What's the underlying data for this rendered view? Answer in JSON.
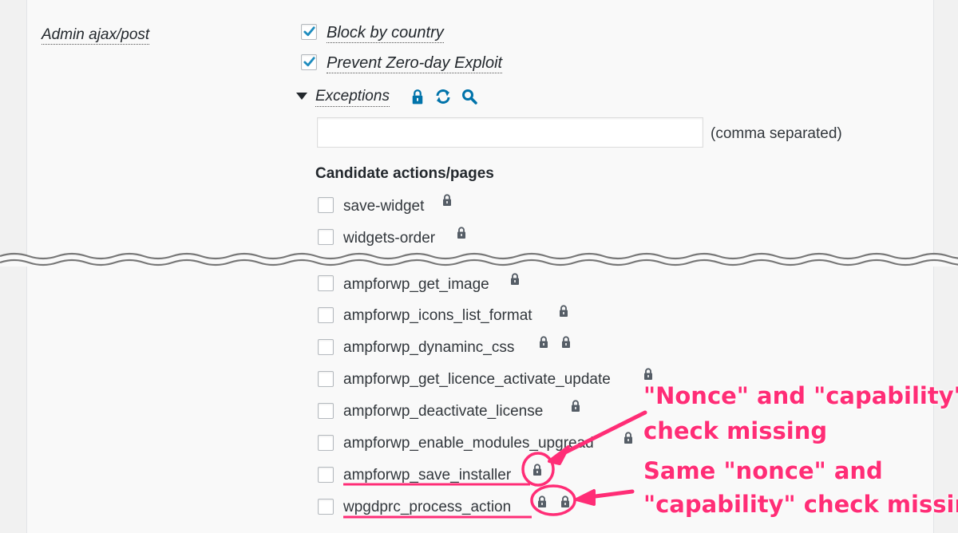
{
  "section": {
    "label": "Admin ajax/post"
  },
  "options": [
    {
      "label": "Block by country",
      "checked": true
    },
    {
      "label": "Prevent Zero-day Exploit",
      "checked": true
    }
  ],
  "exceptions": {
    "toggle_label": "Exceptions",
    "icons": [
      "lock-icon",
      "refresh-icon",
      "search-icon"
    ],
    "input_value": "",
    "hint": "(comma separated)"
  },
  "candidates": {
    "heading": "Candidate actions/pages",
    "items_top": [
      {
        "label": "save-widget",
        "locks": 1
      },
      {
        "label": "widgets-order",
        "locks": 1
      }
    ],
    "items_bottom": [
      {
        "label": "ampforwp_get_image",
        "locks": 1
      },
      {
        "label": "ampforwp_icons_list_format",
        "locks": 1
      },
      {
        "label": "ampforwp_dynaminc_css",
        "locks": 2
      },
      {
        "label": "ampforwp_get_licence_activate_update",
        "locks": 1
      },
      {
        "label": "ampforwp_deactivate_license",
        "locks": 1
      },
      {
        "label": "ampforwp_enable_modules_upgread",
        "locks": 1
      },
      {
        "label": "ampforwp_save_installer",
        "locks": 1
      },
      {
        "label": "wpgdprc_process_action",
        "locks": 2
      }
    ]
  },
  "annotations": {
    "first_line1": "\"Nonce\" and \"capability\"",
    "first_line2": "check missing",
    "second_line1": "Same \"nonce\" and",
    "second_line2": "\"capability\" check missing",
    "color": "#ff2d76"
  }
}
